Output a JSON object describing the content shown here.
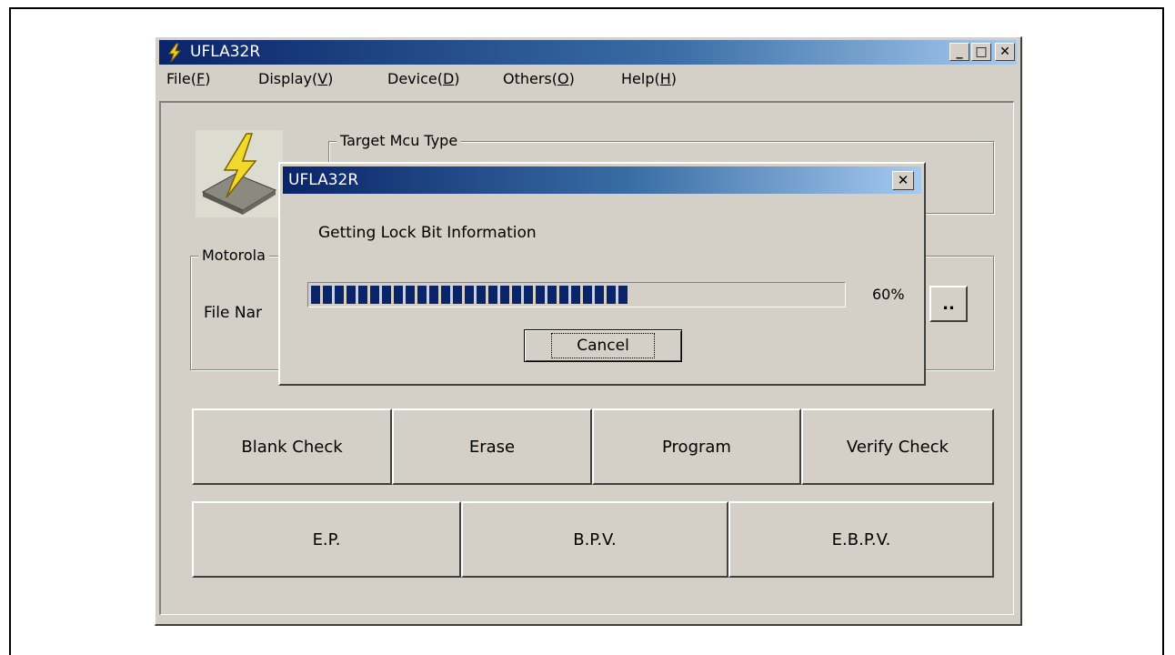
{
  "window": {
    "title": "UFLA32R",
    "min_label": "_",
    "max_label": "□",
    "close_label": "✕"
  },
  "menu": [
    {
      "text": "File(",
      "key": "F"
    },
    {
      "text": "Display(",
      "key": "V"
    },
    {
      "text": "Device(",
      "key": "D"
    },
    {
      "text": "Others(",
      "key": "O"
    },
    {
      "text": "Help(",
      "key": "H"
    }
  ],
  "menu_close": ")",
  "target_group": {
    "label": "Target Mcu Type"
  },
  "file_group": {
    "label": "Motorola",
    "file_label": "File Nar",
    "browse_label": ".."
  },
  "buttons_row1": [
    "Blank Check",
    "Erase",
    "Program",
    "Verify Check"
  ],
  "buttons_row2": [
    "E.P.",
    "B.P.V.",
    "E.B.P.V."
  ],
  "dialog": {
    "title": "UFLA32R",
    "close_label": "✕",
    "message": "Getting Lock Bit Information",
    "progress_percent": 60,
    "progress_text": "60%",
    "cancel_label": "Cancel"
  },
  "colors": {
    "titlebar_start": "#0a246a",
    "progress": "#0a246a",
    "face": "#d4d0c8"
  }
}
